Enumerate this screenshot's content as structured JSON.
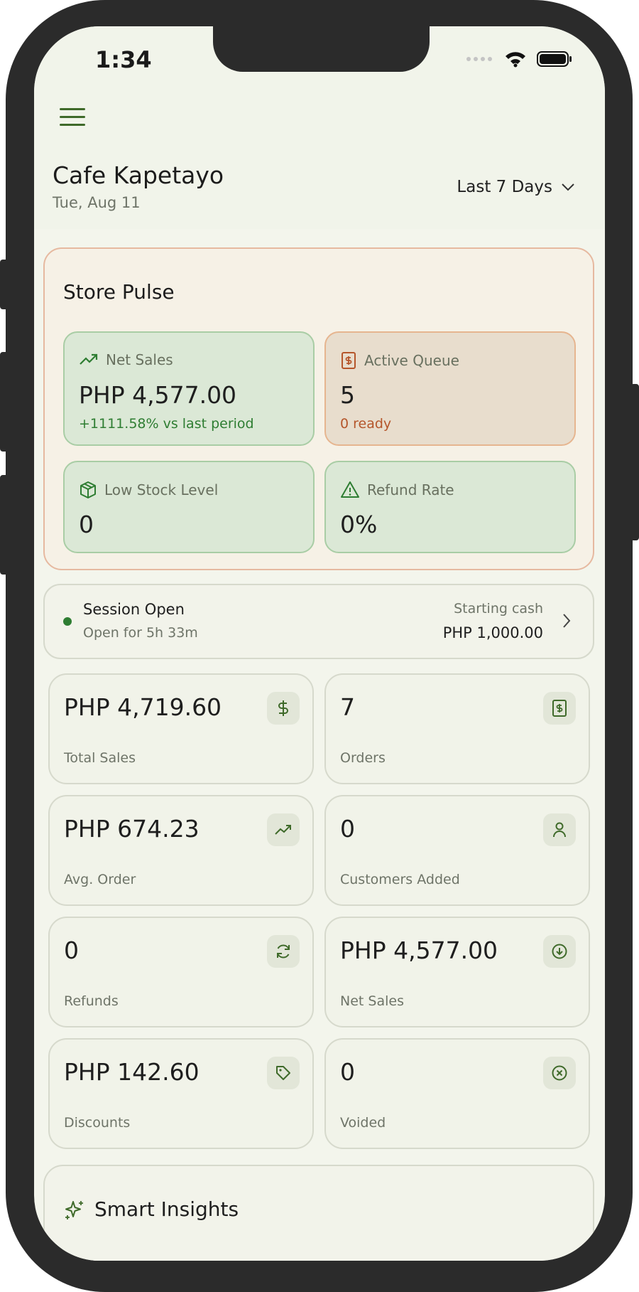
{
  "status_bar": {
    "time": "1:34"
  },
  "header": {
    "store_name": "Cafe Kapetayo",
    "date": "Tue, Aug 11",
    "range_label": "Last 7 Days"
  },
  "store_pulse": {
    "title": "Store Pulse",
    "net_sales": {
      "label": "Net Sales",
      "value": "PHP 4,577.00",
      "sub": "+1111.58% vs last period"
    },
    "active_queue": {
      "label": "Active Queue",
      "value": "5",
      "sub": "0 ready"
    },
    "low_stock": {
      "label": "Low Stock Level",
      "value": "0"
    },
    "refund_rate": {
      "label": "Refund Rate",
      "value": "0%"
    }
  },
  "session": {
    "title": "Session Open",
    "duration": "Open for 5h 33m",
    "cash_label": "Starting cash",
    "cash_value": "PHP 1,000.00"
  },
  "metrics": [
    {
      "value": "PHP 4,719.60",
      "label": "Total Sales",
      "icon": "dollar-icon"
    },
    {
      "value": "7",
      "label": "Orders",
      "icon": "receipt-icon"
    },
    {
      "value": "PHP 674.23",
      "label": "Avg. Order",
      "icon": "trending-up-icon"
    },
    {
      "value": "0",
      "label": "Customers Added",
      "icon": "user-icon"
    },
    {
      "value": "0",
      "label": "Refunds",
      "icon": "refresh-icon"
    },
    {
      "value": "PHP 4,577.00",
      "label": "Net Sales",
      "icon": "arrow-down-circle-icon"
    },
    {
      "value": "PHP 142.60",
      "label": "Discounts",
      "icon": "tag-icon"
    },
    {
      "value": "0",
      "label": "Voided",
      "icon": "x-circle-icon"
    }
  ],
  "insights": {
    "title": "Smart Insights"
  },
  "colors": {
    "accent_green": "#3f6a2a",
    "positive_text": "#2e7d32",
    "warning_text": "#b5562b",
    "tile_green": "#dbe8d6",
    "tile_amber": "#e8ddcd"
  }
}
